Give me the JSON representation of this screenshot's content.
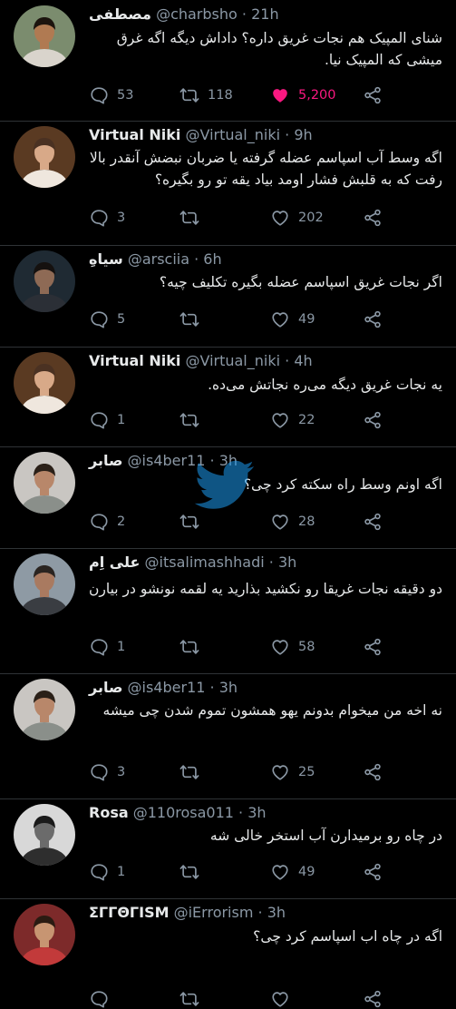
{
  "tweets": [
    {
      "name": "مصطفى",
      "handle": "@charbsho",
      "time": "21h",
      "text": "شنای المپیک هم نجات غریق داره؟ داداش دیگه اگه غرق میشی که المپیک نیا.",
      "replies": "53",
      "retweets": "118",
      "likes": "5,200",
      "liked": true
    },
    {
      "name": "Virtual Niki",
      "handle": "@Virtual_niki",
      "time": "9h",
      "text": "اگه وسط آب اسپاسم عضله گرفته یا ضربان نبضش آنقدر بالا رفت که به قلبش فشار اومد بیاد یقه تو رو بگیره؟",
      "replies": "3",
      "retweets": "",
      "likes": "202",
      "liked": false
    },
    {
      "name": "سیاهِ",
      "handle": "@arsciia",
      "time": "6h",
      "text": "اگر نجات غریق اسپاسم عضله بگیره تکلیف چیه؟",
      "replies": "5",
      "retweets": "",
      "likes": "49",
      "liked": false
    },
    {
      "name": "Virtual Niki",
      "handle": "@Virtual_niki",
      "time": "4h",
      "text": "یه نجات غریق دیگه می‌ره نجاتش می‌ده.",
      "replies": "1",
      "retweets": "",
      "likes": "22",
      "liked": false
    },
    {
      "name": "صابر",
      "handle": "@is4ber11",
      "time": "3h",
      "text": "اگه اونم وسط راه سکته کرد چی؟",
      "replies": "2",
      "retweets": "",
      "likes": "28",
      "liked": false
    },
    {
      "name": "علی اِم",
      "handle": "@itsalimashhadi",
      "time": "3h",
      "text": "دو دقیقه نجات غریقا رو نکشید بذارید یه لقمه نونشو در بیارن",
      "replies": "1",
      "retweets": "",
      "likes": "58",
      "liked": false
    },
    {
      "name": "صابر",
      "handle": "@is4ber11",
      "time": "3h",
      "text": "نه اخه من میخوام بدونم یهو همشون تموم شدن چی میشه",
      "replies": "3",
      "retweets": "",
      "likes": "25",
      "liked": false
    },
    {
      "name": "Rosa",
      "handle": "@110rosa011",
      "time": "3h",
      "text": "در چاه رو برمیدارن آب استخر خالی شه",
      "replies": "1",
      "retweets": "",
      "likes": "49",
      "liked": false
    },
    {
      "name": "ΣΓΓΘΓISM",
      "handle": "@iErrorism",
      "time": "3h",
      "text": "اگه در چاه اب اسپاسم کرد چی؟",
      "replies": "",
      "retweets": "",
      "likes": "",
      "liked": false
    }
  ],
  "colors": {
    "background": "#000000",
    "text": "#e7e9ea",
    "muted": "#8b98a5",
    "like": "#f91880",
    "divider": "#2f3336"
  },
  "icons": [
    "reply-icon",
    "retweet-icon",
    "like-icon",
    "share-icon"
  ]
}
